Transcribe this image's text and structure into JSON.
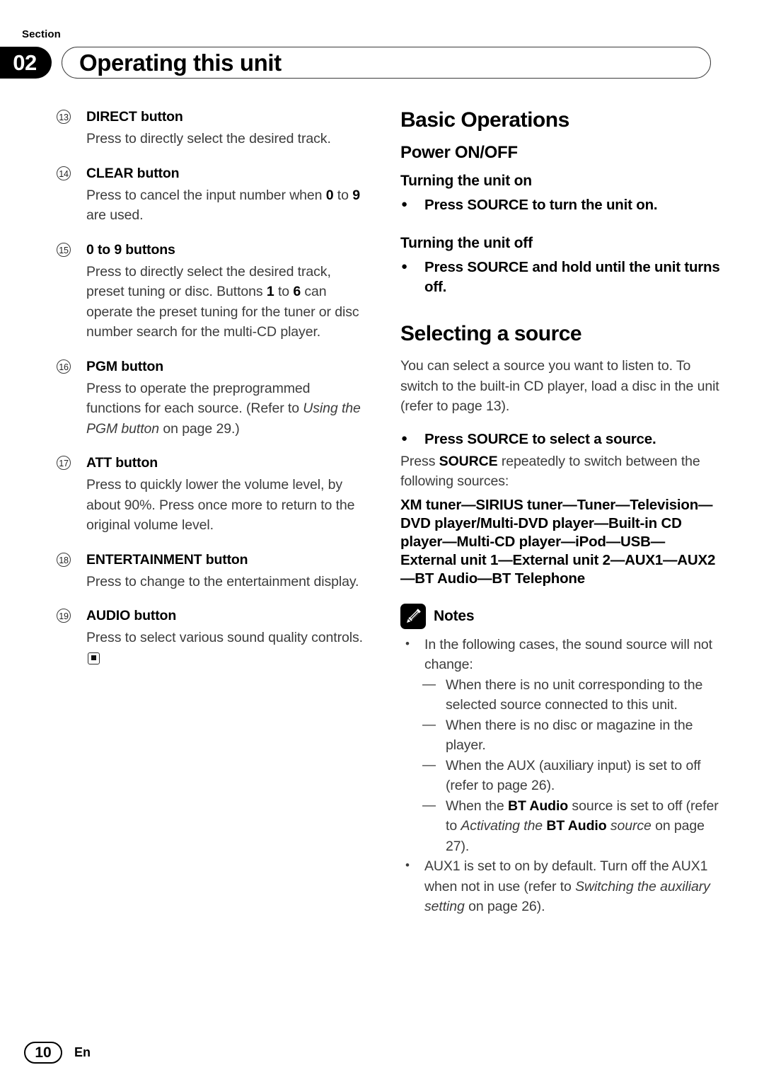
{
  "header": {
    "section_label": "Section",
    "section_number": "02",
    "title": "Operating this unit"
  },
  "left_column": {
    "items": [
      {
        "num": "13",
        "title": "DIRECT button",
        "body_html": "Press to directly select the desired track."
      },
      {
        "num": "14",
        "title": "CLEAR button",
        "body_html": "Press to cancel the input number when <b>0</b> to <b>9</b> are used."
      },
      {
        "num": "15",
        "title": "0 to 9 buttons",
        "body_html": "Press to directly select the desired track, preset tuning or disc. Buttons <b>1</b> to <b>6</b> can operate the preset tuning for the tuner or disc number search for the multi-CD player."
      },
      {
        "num": "16",
        "title": "PGM button",
        "body_html": "Press to operate the preprogrammed functions for each source. (Refer to <i>Using the PGM button</i> on page 29.)"
      },
      {
        "num": "17",
        "title": "ATT button",
        "body_html": "Press to quickly lower the volume level, by about 90%. Press once more to return to the original volume level."
      },
      {
        "num": "18",
        "title": "ENTERTAINMENT button",
        "body_html": "Press to change to the entertainment display."
      },
      {
        "num": "19",
        "title": "AUDIO button",
        "body_html": "Press to select various sound quality controls.<span class=\"end-mark\" data-name=\"end-of-section-marker\"></span>"
      }
    ]
  },
  "right_column": {
    "heading_basic_operations": "Basic Operations",
    "heading_power": "Power ON/OFF",
    "turning_on": {
      "heading": "Turning the unit on",
      "instruction": "Press SOURCE to turn the unit on."
    },
    "turning_off": {
      "heading": "Turning the unit off",
      "instruction": "Press SOURCE and hold until the unit turns off."
    },
    "heading_selecting_source": "Selecting a source",
    "selecting_intro": "You can select a source you want to listen to. To switch to the built-in CD player, load a disc in the unit (refer to page 13).",
    "select_instruction": "Press SOURCE to select a source.",
    "select_followup_html": "Press <b>SOURCE</b> repeatedly to switch between the following sources:",
    "source_chain": "XM tuner—SIRIUS tuner—Tuner—Television—DVD player/Multi-DVD player—Built-in CD player—Multi-CD player—iPod—USB—External unit 1—External unit 2—AUX1—AUX2—BT Audio—BT Telephone",
    "notes": {
      "icon": "pencil-icon",
      "title": "Notes",
      "items": [
        {
          "type": "bullet",
          "text_html": "In the following cases, the sound source will not change:"
        },
        {
          "type": "dash",
          "text_html": "When there is no unit corresponding to the selected source connected to this unit."
        },
        {
          "type": "dash",
          "text_html": "When there is no disc or magazine in the player."
        },
        {
          "type": "dash",
          "text_html": "When the AUX (auxiliary input) is set to off (refer to page 26)."
        },
        {
          "type": "dash",
          "text_html": "When the <b>BT Audio</b> source is set to off (refer to <i>Activating the </i><b>BT Audio</b><i> source</i> on page 27)."
        },
        {
          "type": "bullet",
          "text_html": "AUX1 is set to on by default. Turn off the AUX1 when not in use (refer to <i>Switching the auxiliary setting</i> on page 26)."
        }
      ]
    }
  },
  "footer": {
    "page_number": "10",
    "language": "En"
  }
}
